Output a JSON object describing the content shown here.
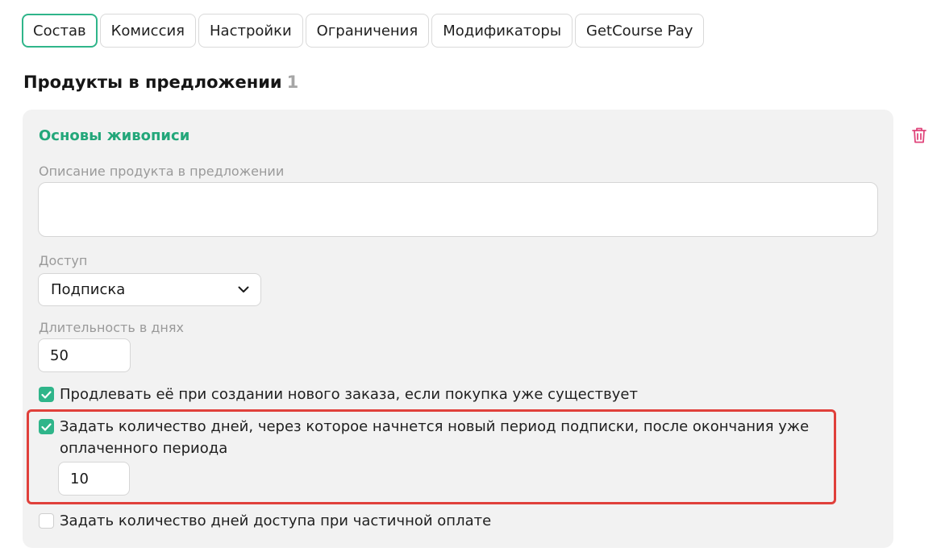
{
  "tabs": [
    {
      "label": "Состав",
      "active": true
    },
    {
      "label": "Комиссия",
      "active": false
    },
    {
      "label": "Настройки",
      "active": false
    },
    {
      "label": "Ограничения",
      "active": false
    },
    {
      "label": "Модификаторы",
      "active": false
    },
    {
      "label": "GetCourse Pay",
      "active": false
    }
  ],
  "section": {
    "title": "Продукты в предложении",
    "count": "1"
  },
  "product": {
    "name": "Основы живописи",
    "description_label": "Описание продукта в предложении",
    "description_value": "",
    "access_label": "Доступ",
    "access_value": "Подписка",
    "duration_label": "Длительность в днях",
    "duration_value": "50",
    "extend_label": "Продлевать её при создании нового заказа, если покупка уже существует",
    "extend_checked": true,
    "delay_label": "Задать количество дней, через которое начнется новый период подписки, после окончания уже оплаченного периода",
    "delay_checked": true,
    "delay_value": "10",
    "partial_label": "Задать количество дней доступа при частичной оплате",
    "partial_checked": false
  },
  "icons": {
    "trash": "trash-icon",
    "chevron": "chevron-down-icon",
    "check": "check-icon"
  },
  "colors": {
    "accent": "#2fb58a",
    "highlight": "#e0403b",
    "danger": "#e0457b"
  }
}
